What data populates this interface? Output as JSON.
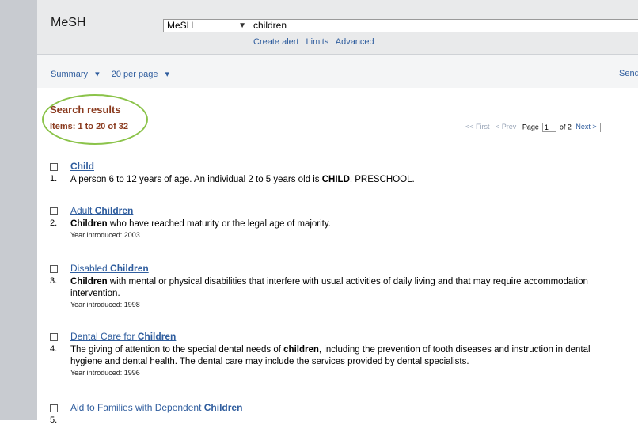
{
  "header": {
    "db_title": "MeSH",
    "db_select_value": "MeSH",
    "search_value": "children",
    "links": [
      "Create alert",
      "Limits",
      "Advanced"
    ]
  },
  "toolbar": {
    "summary_label": "Summary",
    "per_page_label": "20 per page",
    "send_label": "Send"
  },
  "results_header": {
    "title": "Search results",
    "items": "Items: 1 to 20 of 32"
  },
  "pager": {
    "first": "<< First",
    "prev": "< Prev",
    "page_label": "Page",
    "page_value": "1",
    "of_label": "of 2",
    "next": "Next >"
  },
  "results": [
    {
      "num": "1.",
      "title_pre": "",
      "title_bold": "Child",
      "title_post": "",
      "desc": [
        [
          [
            "A person 6 to 12 years of age. An individual 2 to 5 years old is ",
            false
          ],
          [
            "CHILD",
            true
          ],
          [
            ", PRESCHOOL.",
            false
          ]
        ]
      ],
      "year": ""
    },
    {
      "num": "2.",
      "title_pre": "Adult ",
      "title_bold": "Children",
      "title_post": "",
      "desc": [
        [
          [
            "Children",
            true
          ],
          [
            " who have reached maturity or the legal age of majority.",
            false
          ]
        ]
      ],
      "year": "Year introduced: 2003"
    },
    {
      "num": "3.",
      "title_pre": "Disabled ",
      "title_bold": "Children",
      "title_post": "",
      "desc": [
        [
          [
            "Children",
            true
          ],
          [
            " with mental or physical disabilities that interfere with usual activities of daily living and that may require accommodation",
            false
          ]
        ],
        [
          [
            "intervention.",
            false
          ]
        ]
      ],
      "year": "Year introduced: 1998"
    },
    {
      "num": "4.",
      "title_pre": "Dental Care for ",
      "title_bold": "Children",
      "title_post": "",
      "desc": [
        [
          [
            "The giving of attention to the special dental needs of ",
            false
          ],
          [
            "children",
            true
          ],
          [
            ", including the prevention of tooth diseases and instruction in dental",
            false
          ]
        ],
        [
          [
            "hygiene and dental health. The dental care may include the services provided by dental specialists.",
            false
          ]
        ]
      ],
      "year": "Year introduced: 1996"
    },
    {
      "num": "5.",
      "title_pre": "Aid to Families with Dependent ",
      "title_bold": "Children",
      "title_post": "",
      "desc": [],
      "year": ""
    }
  ]
}
